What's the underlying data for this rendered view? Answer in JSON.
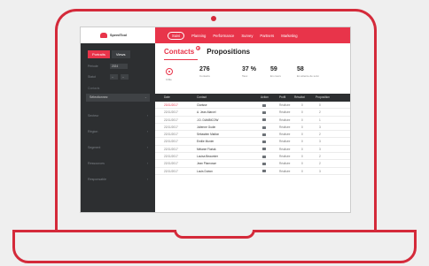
{
  "nav": {
    "brand": "SpeedTool",
    "items": [
      {
        "label": "Suivi",
        "active": true
      },
      {
        "label": "Planning",
        "active": false
      },
      {
        "label": "Performance",
        "active": false
      },
      {
        "label": "Survey",
        "active": false
      },
      {
        "label": "Partners",
        "active": false
      },
      {
        "label": "Marketing",
        "active": false
      }
    ]
  },
  "sidebar": {
    "tabs": [
      "Portraits",
      "Views"
    ],
    "filters": [
      {
        "label": "Période",
        "value": "2024"
      },
      {
        "label": "Statut",
        "value": "--",
        "value2": "--"
      }
    ],
    "section": "Contacts",
    "select": "Sélectionnez",
    "groups": [
      "Secteur",
      "Région",
      "Segment",
      "Ressources",
      "Responsable"
    ]
  },
  "tabs": {
    "contacts": "Contacts",
    "contacts_badge": "8",
    "propositions": "Propositions"
  },
  "stats": {
    "icon_label": "Cible",
    "items": [
      {
        "value": "276",
        "label": "Contacts"
      },
      {
        "value": "37 %",
        "label": "Taux"
      },
      {
        "value": "59",
        "label": "En cours"
      },
      {
        "value": "58",
        "label": "En attente de suivi"
      }
    ]
  },
  "table": {
    "columns": [
      "Date",
      "Contact",
      "Action",
      "Profil",
      "Résultat",
      "Proposition"
    ],
    "rows": [
      {
        "date": "23/11/2017",
        "name": "Clarisse",
        "status": "Réalisée",
        "n1": "0",
        "n2": "0",
        "hl": true
      },
      {
        "date": "22/11/2017",
        "name": "A. Jean-Marcel",
        "status": "Réalisée",
        "n1": "0",
        "n2": "2",
        "hl": false
      },
      {
        "date": "22/11/2017",
        "name": "J.D. DAMBICOW",
        "status": "Réalisée",
        "n1": "0",
        "n2": "1",
        "hl": false
      },
      {
        "date": "22/11/2017",
        "name": "Julienne Gudin",
        "status": "Réalisée",
        "n1": "0",
        "n2": "3",
        "hl": false
      },
      {
        "date": "22/11/2017",
        "name": "Sébastien Mailion",
        "status": "Réalisée",
        "n1": "0",
        "n2": "2",
        "hl": false
      },
      {
        "date": "22/11/2017",
        "name": "Emilie Munier",
        "status": "Réalisée",
        "n1": "0",
        "n2": "3",
        "hl": false
      },
      {
        "date": "22/11/2017",
        "name": "Mélanie Floriak",
        "status": "Réalisée",
        "n1": "0",
        "n2": "3",
        "hl": false
      },
      {
        "date": "22/11/2017",
        "name": "Louisa Beaumier",
        "status": "Réalisée",
        "n1": "0",
        "n2": "2",
        "hl": false
      },
      {
        "date": "22/11/2017",
        "name": "Jean Planrosse",
        "status": "Réalisée",
        "n1": "0",
        "n2": "2",
        "hl": false
      },
      {
        "date": "22/11/2017",
        "name": "Louis Dubon",
        "status": "Réalisée",
        "n1": "0",
        "n2": "3",
        "hl": false
      }
    ]
  },
  "colors": {
    "accent": "#e8344a",
    "sidebar": "#2d2f31"
  }
}
